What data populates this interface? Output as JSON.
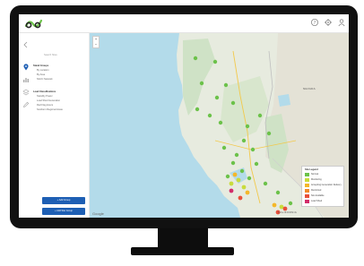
{
  "topbar": {
    "icons": [
      "help-icon",
      "settings-icon",
      "user-icon"
    ]
  },
  "sidebar": {
    "search_label": "Search Sites",
    "group1": {
      "title": "Stand Groups",
      "items": [
        "By Location",
        "By Area",
        "NACC Network"
      ]
    },
    "group2": {
      "title": "Load Classifications",
      "items": [
        "Standby Power",
        "Load Shed Generation",
        "Red Flag Hours",
        "Southern Regional Areas"
      ]
    },
    "buttons": {
      "add_group": "+ Add Group",
      "add_site": "+ Add Site Group"
    }
  },
  "map": {
    "zoom_in": "+",
    "zoom_out": "−",
    "attribution": "Google",
    "labels": {
      "nevada": "NEVADA",
      "california": "CALIFORNIA"
    },
    "legend": {
      "title": "Site Legend",
      "entries": [
        {
          "label": "Normal",
          "color": "#6cc24a"
        },
        {
          "label": "Monitoring",
          "color": "#c9dc3c"
        },
        {
          "label": "Accepting Generation Delivery",
          "color": "#f4b72a"
        },
        {
          "label": "Restricted",
          "color": "#f28a2a"
        },
        {
          "label": "Not Available",
          "color": "#e8503a"
        },
        {
          "label": "Load Shed",
          "color": "#d22d6a"
        }
      ]
    }
  }
}
